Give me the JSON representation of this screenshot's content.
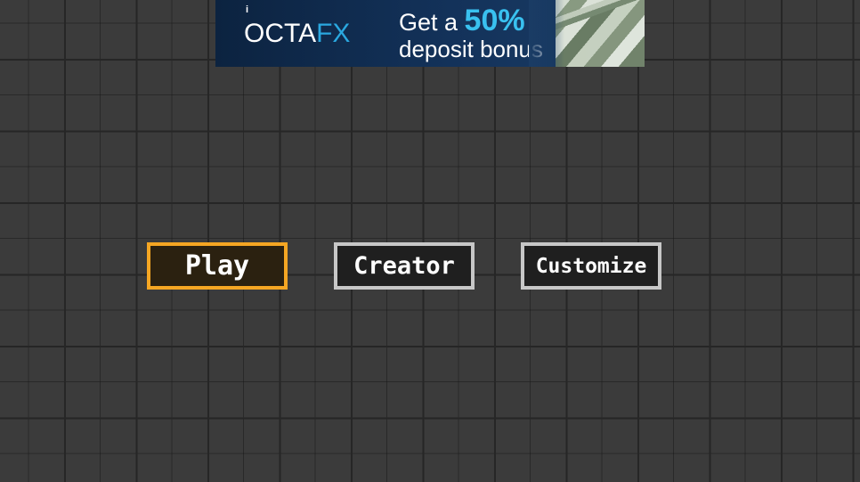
{
  "ad": {
    "info_icon": "i",
    "logo_part1": "OCTA",
    "logo_part2": "FX",
    "headline_prefix": "Get a ",
    "headline_percent": "50%",
    "subline": "deposit bonus",
    "image": "money-stack-image"
  },
  "menu": {
    "play_label": "Play",
    "creator_label": "Creator",
    "customize_label": "Customize",
    "selected": "Play"
  },
  "colors": {
    "background": "#3b3b3b",
    "grid_line": "#262626",
    "selected_border": "#f5a623",
    "button_border": "#c7c7c7",
    "button_fill": "#1f1f1f",
    "ad_background": "#0c2340",
    "ad_accent": "#39c1f0"
  }
}
